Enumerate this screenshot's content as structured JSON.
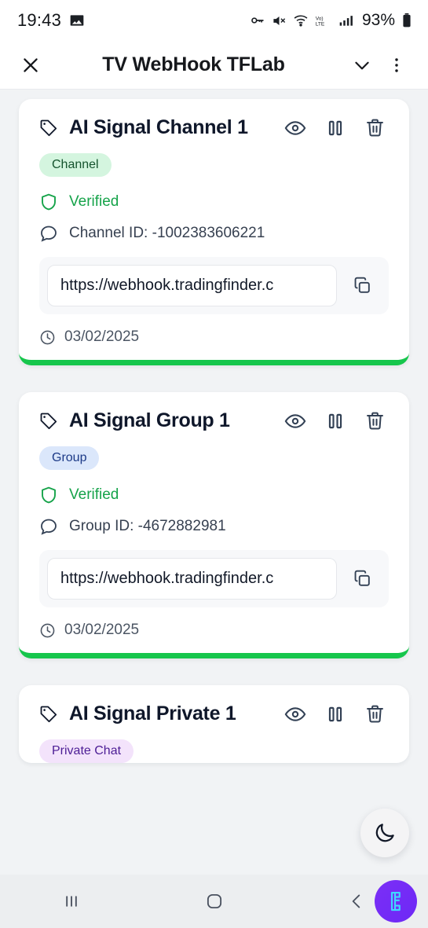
{
  "status_bar": {
    "time": "19:43",
    "battery_percent": "93%",
    "icons": [
      "image-icon",
      "key-icon",
      "mute-icon",
      "wifi-icon",
      "volte-icon",
      "signal-icon",
      "battery-icon"
    ]
  },
  "app_bar": {
    "close_label": "close-icon",
    "title": "TV WebHook TFLab",
    "dropdown_label": "chevron-down-icon",
    "menu_label": "more-vertical-icon"
  },
  "colors": {
    "accent_green": "#16c64c",
    "verified_green": "#16a34a",
    "badge_channel_bg": "#d4f5df",
    "badge_group_bg": "#dbe7fb",
    "badge_private_bg": "#f3e3fb",
    "fab_purple": "#6d28f5"
  },
  "cards": [
    {
      "title": "AI Signal Channel 1",
      "badge": "Channel",
      "verified": "Verified",
      "chat_id": "Channel ID: -1002383606221",
      "webhook_url": "https://webhook.tradingfinder.c",
      "date": "03/02/2025"
    },
    {
      "title": "AI Signal Group 1",
      "badge": "Group",
      "verified": "Verified",
      "chat_id": "Group ID: -4672882981",
      "webhook_url": "https://webhook.tradingfinder.c",
      "date": "03/02/2025"
    },
    {
      "title": "AI Signal Private 1",
      "badge": "Private Chat"
    }
  ],
  "card_actions": {
    "view": "eye-icon",
    "pause": "pause-icon",
    "delete": "trash-icon",
    "copy": "copy-icon"
  },
  "fab": {
    "label": "moon-icon"
  },
  "nav_bar": {
    "recents": "recents-icon",
    "home": "home-icon",
    "back": "back-icon",
    "app_badge": "tradingfinder-logo"
  }
}
